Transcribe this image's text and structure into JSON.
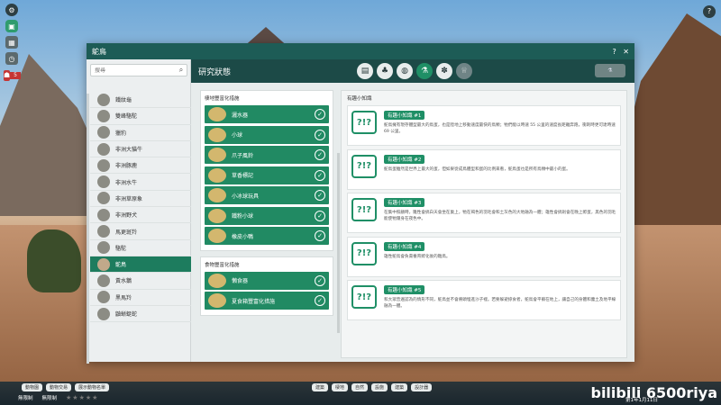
{
  "window": {
    "title": "鴕鳥",
    "help": "?",
    "close": "✕"
  },
  "sidebar": {
    "search_placeholder": "搜尋",
    "items": [
      {
        "label": "鐵紋龜"
      },
      {
        "label": "雙峰駱駝"
      },
      {
        "label": "獵豹"
      },
      {
        "label": "非洲大貓牛"
      },
      {
        "label": "非洲豚鹿"
      },
      {
        "label": "非洲水牛"
      },
      {
        "label": "非洲草原象"
      },
      {
        "label": "非洲野犬"
      },
      {
        "label": "馬更斑羚"
      },
      {
        "label": "駱駝"
      },
      {
        "label": "鴕鳥",
        "selected": true
      },
      {
        "label": "黃水鵝"
      },
      {
        "label": "黑馬羚"
      },
      {
        "label": "鼬蜥蜓蛇"
      }
    ]
  },
  "header": {
    "title": "研究狀態",
    "categories": [
      {
        "icon": "document-icon",
        "glyph": "▤"
      },
      {
        "icon": "tree-icon",
        "glyph": "♣"
      },
      {
        "icon": "food-icon",
        "glyph": "◍"
      },
      {
        "icon": "flask-icon",
        "glyph": "⚗",
        "active": true
      },
      {
        "icon": "paw-icon",
        "glyph": "✽"
      },
      {
        "icon": "trophy-icon",
        "glyph": "♕",
        "dim": true
      }
    ]
  },
  "enrichment_habitat": {
    "title": "棲地豐富化措施",
    "items": [
      {
        "label": "灑水器"
      },
      {
        "label": "小球"
      },
      {
        "label": "爪子風鈴"
      },
      {
        "label": "草香標記"
      },
      {
        "label": "小冰球玩具"
      },
      {
        "label": "鐵粉小球"
      },
      {
        "label": "橡皮小鴨"
      }
    ]
  },
  "enrichment_food": {
    "title": "食物豐富化措施",
    "items": [
      {
        "label": "懶食器"
      },
      {
        "label": "夏食箱豐富化措施"
      }
    ]
  },
  "facts": {
    "title": "有趣小知識",
    "items": [
      {
        "label": "有趣小知識 #1",
        "text": "鴕鳥擁有現存體型最大的鳥蛋，也是陸地上移動速度最快的鳥類；牠們能以時速 55 公里的速度長距離奔跑，衝刺時更可達時速 69 公里。"
      },
      {
        "label": "有趣小知識 #2",
        "text": "鴕鳥蛋雖然是世界上最大的蛋，但如果從成鳥體型和蛋的比例來看，鴕鳥蛋也是所有鳥類中最小的蛋。"
      },
      {
        "label": "有趣小知識 #3",
        "text": "在集中照顧時，雛性會搞白天會坐在巢上，牠在褐色的羽毛會和土灰色的大地融為一體；雄性會搞則會在晚上孵蛋，黑色的羽毛能使牠隱身在夜色中。"
      },
      {
        "label": "有趣小知識 #4",
        "text": "雄性鴕鳥會負責養育孵化後的雛鳥。"
      },
      {
        "label": "有趣小知識 #5",
        "text": "和大眾普遍認為的情形不同，鴕鳥並不會將頭埋進沙子裡。若要躲避掠食者，鴕鳥會平躺在地上，讓自己的身體和塵土及地平線融為一體。"
      }
    ]
  },
  "bottom": {
    "left_pills": [
      "動物園",
      "動物交易",
      "展示動物名單"
    ],
    "money1": "無限制",
    "money2": "無限制",
    "center_pills": [
      "建築",
      "棲地",
      "自然",
      "設施",
      "建築",
      "設計器"
    ],
    "date": "第1年1月11日",
    "watermark": "bilibili 6500riya"
  }
}
